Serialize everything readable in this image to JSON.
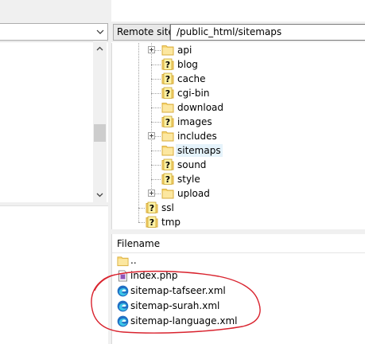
{
  "remote_site": {
    "label": "Remote site:",
    "path": "/public_html/sitemaps"
  },
  "tree": [
    {
      "name": "api",
      "icon": "folder",
      "expandable": true
    },
    {
      "name": "blog",
      "icon": "folder-unknown",
      "expandable": false
    },
    {
      "name": "cache",
      "icon": "folder-unknown",
      "expandable": false
    },
    {
      "name": "cgi-bin",
      "icon": "folder-unknown",
      "expandable": false
    },
    {
      "name": "download",
      "icon": "folder",
      "expandable": false
    },
    {
      "name": "images",
      "icon": "folder-unknown",
      "expandable": false
    },
    {
      "name": "includes",
      "icon": "folder",
      "expandable": true
    },
    {
      "name": "sitemaps",
      "icon": "folder",
      "expandable": false,
      "selected": true
    },
    {
      "name": "sound",
      "icon": "folder-unknown",
      "expandable": false
    },
    {
      "name": "style",
      "icon": "folder-unknown",
      "expandable": false
    },
    {
      "name": "upload",
      "icon": "folder",
      "expandable": true
    },
    {
      "name": "ssl",
      "icon": "folder-unknown",
      "expandable": false
    },
    {
      "name": "tmp",
      "icon": "folder-unknown",
      "expandable": false
    }
  ],
  "file_list": {
    "column_header": "Filename",
    "files": [
      {
        "name": "..",
        "icon": "folder-icon"
      },
      {
        "name": "index.php",
        "icon": "php-file-icon"
      },
      {
        "name": "sitemap-tafseer.xml",
        "icon": "edge-file-icon"
      },
      {
        "name": "sitemap-surah.xml",
        "icon": "edge-file-icon"
      },
      {
        "name": "sitemap-language.xml",
        "icon": "edge-file-icon"
      }
    ]
  },
  "colors": {
    "folder": "#f5d47a",
    "folder_border": "#d9ad3d",
    "unknown_badge": "#fbe35a",
    "annotation_red": "#d9232e",
    "selection": "#e5f3fb"
  }
}
